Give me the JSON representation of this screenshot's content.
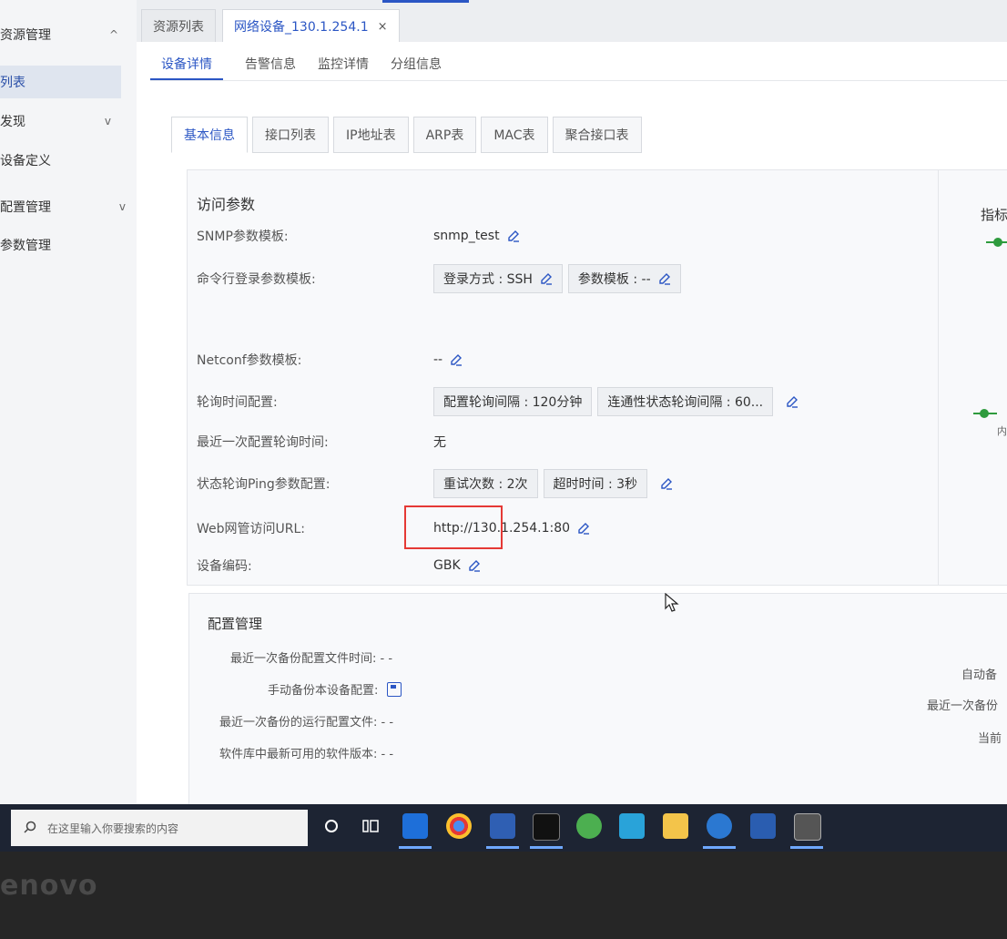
{
  "sidebar": {
    "items": [
      {
        "label": "资源管理",
        "chevron": "^"
      },
      {
        "label": "列表"
      },
      {
        "label": "发现",
        "chevron": "v"
      },
      {
        "label": "设备定义"
      },
      {
        "label": "配置管理",
        "chevron": "v"
      },
      {
        "label": "参数管理"
      }
    ]
  },
  "tabs": [
    {
      "label": "资源列表"
    },
    {
      "label": "网络设备_130.1.254.1",
      "close": "×"
    }
  ],
  "subtabs": [
    "设备详情",
    "告警信息",
    "监控详情",
    "分组信息"
  ],
  "inner_tabs": [
    "基本信息",
    "接口列表",
    "IP地址表",
    "ARP表",
    "MAC表",
    "聚合接口表"
  ],
  "access": {
    "title": "访问参数",
    "rows": [
      {
        "label": "SNMP参数模板:",
        "value": "snmp_test"
      },
      {
        "label": "命令行登录参数模板:",
        "chips": [
          "登录方式 : SSH",
          "参数模板 : --"
        ]
      },
      {
        "label": "Netconf参数模板:",
        "value": "--"
      },
      {
        "label": "轮询时间配置:",
        "chips": [
          "配置轮询间隔 : 120分钟",
          "连通性状态轮询间隔 : 60..."
        ]
      },
      {
        "label": "最近一次配置轮询时间:",
        "value": "无"
      },
      {
        "label": "状态轮询Ping参数配置:",
        "chips": [
          "重试次数 : 2次",
          "超时时间 : 3秒"
        ]
      },
      {
        "label": "Web网管访问URL:",
        "value": "http://130.1.254.1:80"
      },
      {
        "label": "设备编码:",
        "value": "GBK"
      }
    ]
  },
  "right_panel": {
    "title": "指标",
    "sub": "内"
  },
  "config": {
    "title": "配置管理",
    "rows": [
      {
        "label": "最近一次备份配置文件时间:",
        "value": "- -"
      },
      {
        "label": "手动备份本设备配置:"
      },
      {
        "label": "最近一次备份的运行配置文件:",
        "value": "- -"
      },
      {
        "label": "软件库中最新可用的软件版本:",
        "value": "- -"
      }
    ],
    "right_labels": [
      "自动备",
      "最近一次备份",
      "当前"
    ]
  },
  "taskbar": {
    "search_placeholder": "在这里输入你要搜索的内容"
  },
  "brand": "enovo",
  "colors": {
    "accent": "#2b56c4",
    "highlight": "#e53935",
    "status": "#2e9b3d"
  }
}
